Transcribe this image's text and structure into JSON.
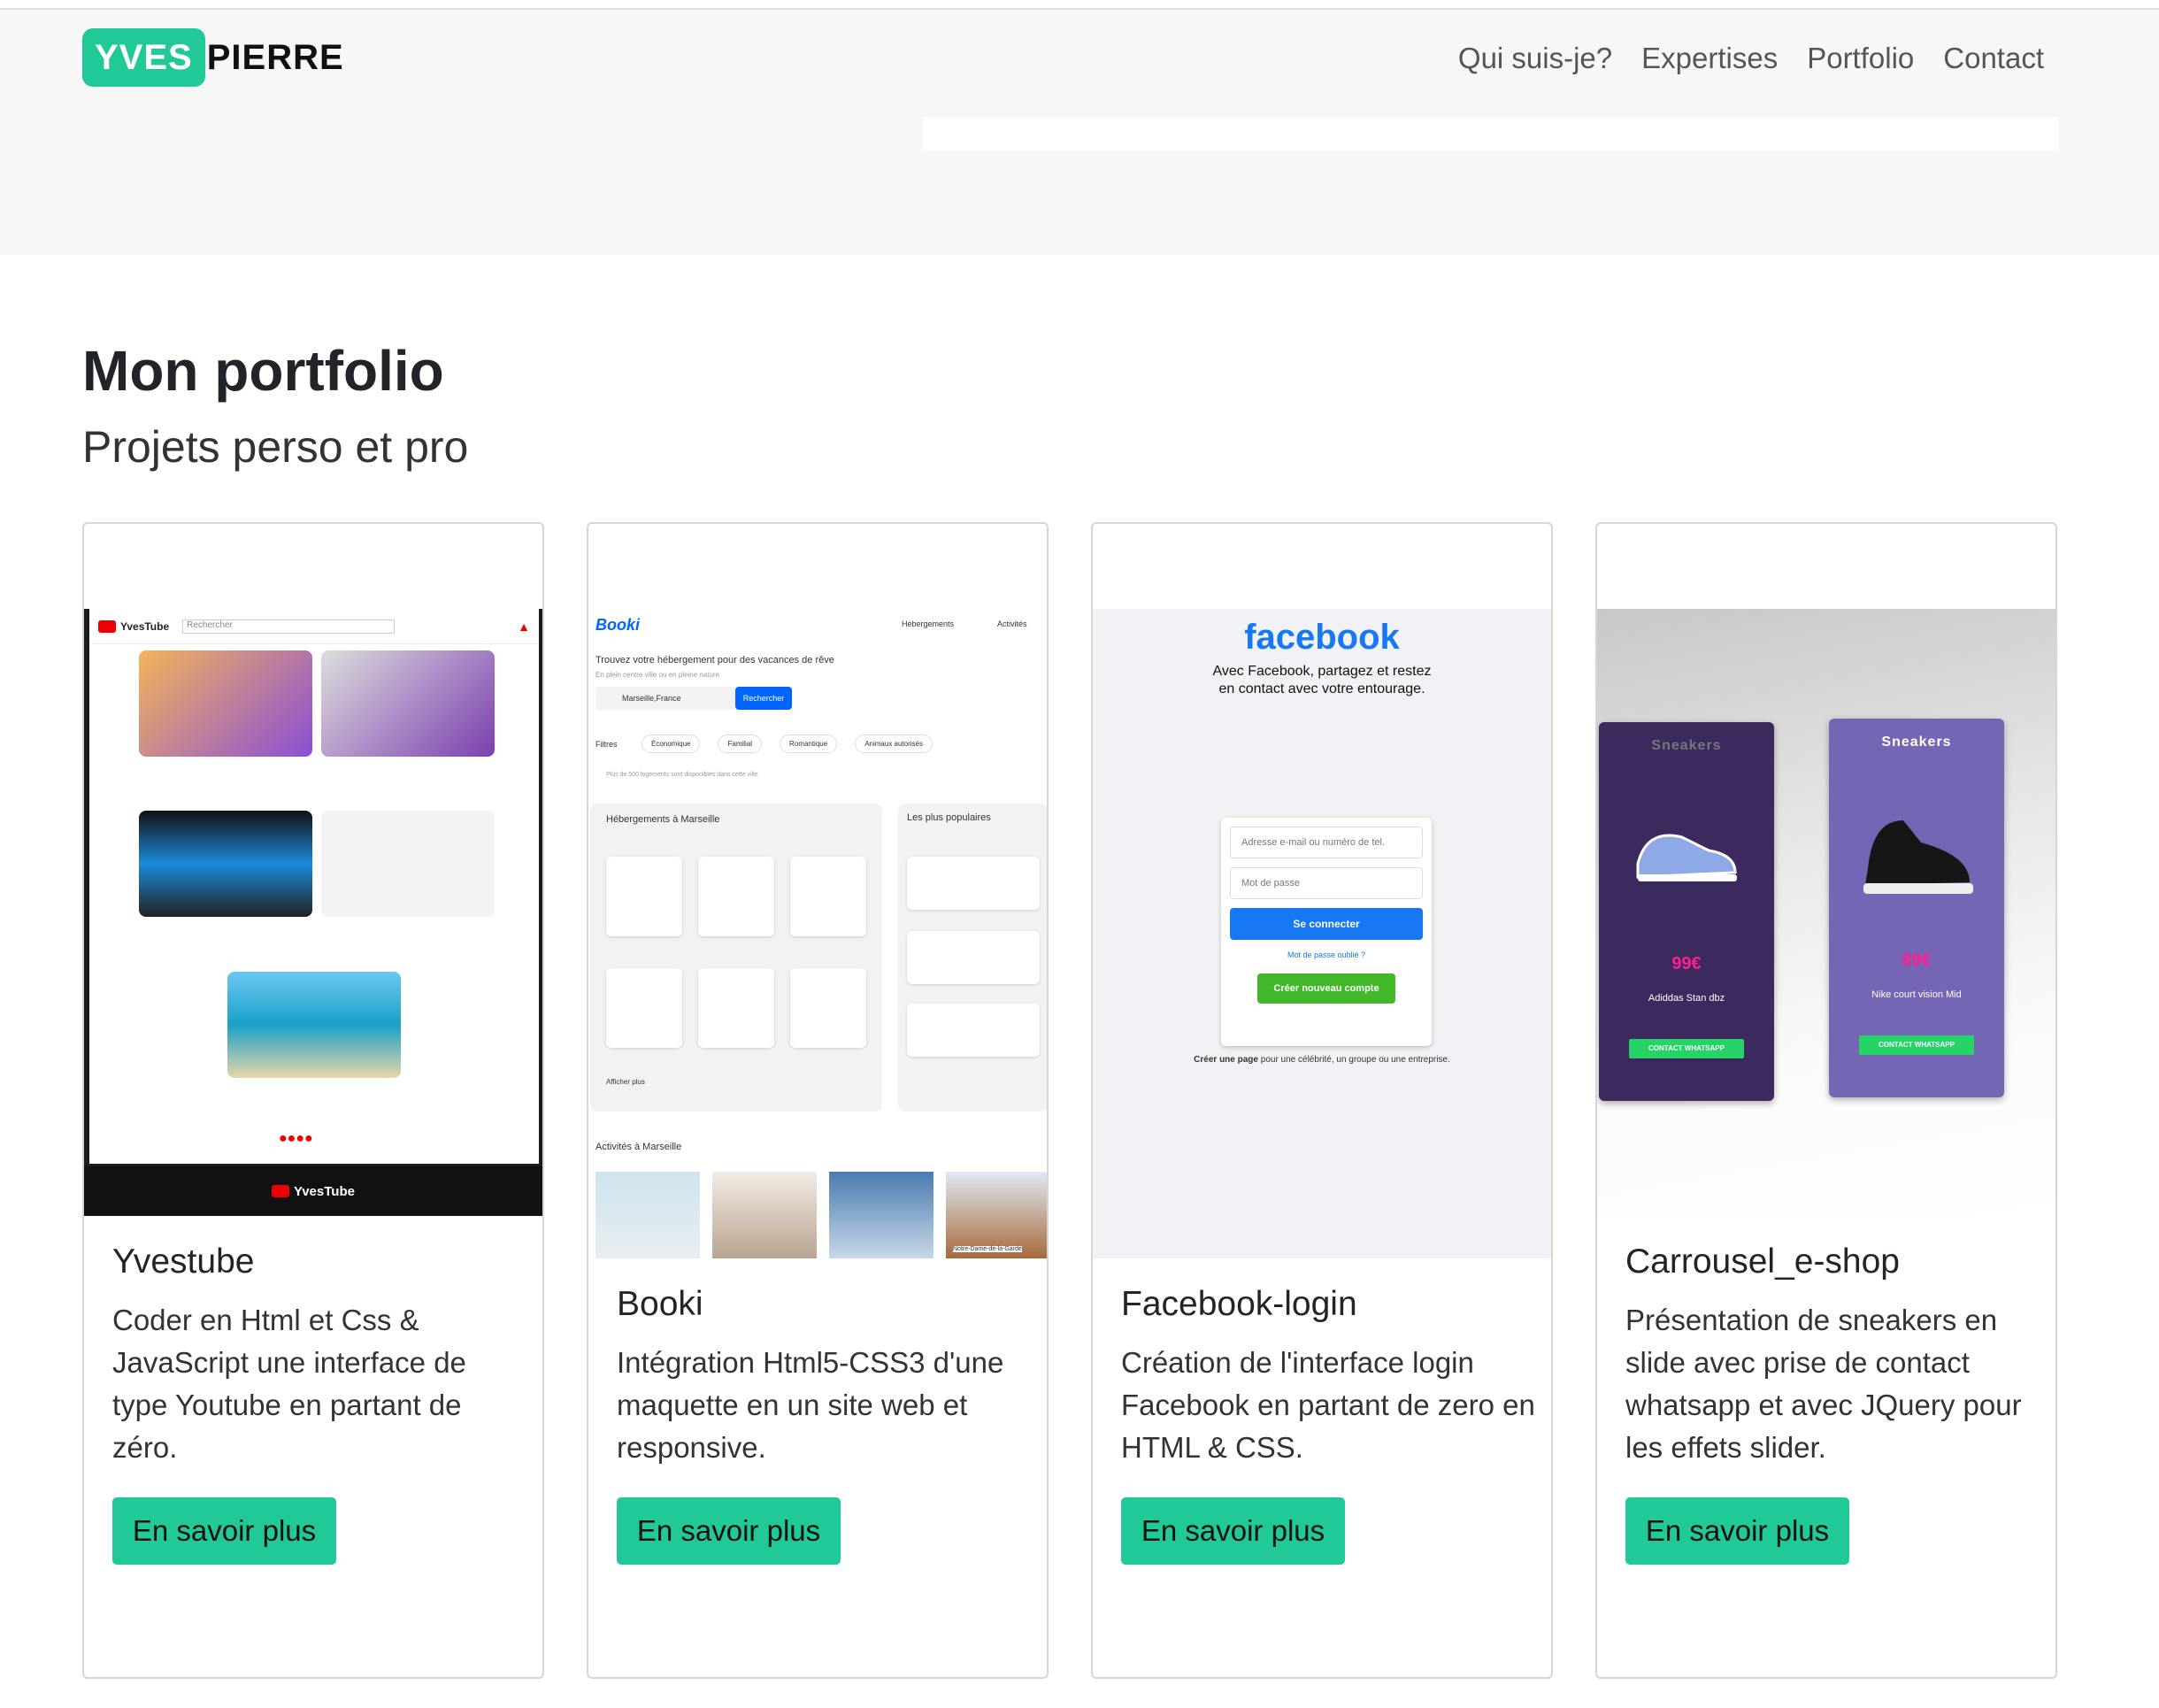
{
  "header": {
    "logo_first": "YVES",
    "logo_last": "PIERRE",
    "nav": [
      "Qui suis-je?",
      "Expertises",
      "Portfolio",
      "Contact"
    ]
  },
  "main": {
    "title": "Mon portfolio",
    "subtitle": "Projets perso et pro"
  },
  "cards": [
    {
      "title": "Yvestube",
      "text": "Coder en Html et Css & JavaScript une interface de type Youtube en partant de zéro.",
      "button": "En savoir plus",
      "thumb": {
        "brand": "YvesTube",
        "search": "Rechercher"
      }
    },
    {
      "title": "Booki",
      "text": "Intégration Html5-CSS3 d'une maquette en un site web et responsive.",
      "button": "En savoir plus",
      "thumb": {
        "brand": "Booki",
        "nav1": "Hébergements",
        "nav2": "Activités",
        "headline": "Trouvez votre hébergement pour des vacances de rêve",
        "sub": "En plein centre ville ou en pleine nature",
        "city": "Marseille,France",
        "search": "Rechercher",
        "filters_label": "Filtres",
        "filters": [
          "Économique",
          "Familial",
          "Romantique",
          "Animaux autorisés"
        ],
        "info": "Plus de 500 logements sont disponibles dans cette ville",
        "lodgings": "Hébergements à Marseille",
        "popular": "Les plus populaires",
        "more": "Afficher plus",
        "activities": "Activités à Marseille",
        "caption": "Notre-Dame-de-la-Garde"
      }
    },
    {
      "title": "Facebook-login",
      "text": "Création de l'interface login Facebook en partant de zero en HTML & CSS.",
      "button": "En savoir plus",
      "thumb": {
        "logo": "facebook",
        "tagline1": "Avec Facebook, partagez et restez",
        "tagline2": "en contact avec votre entourage.",
        "email": "Adresse e-mail ou numéro de tel.",
        "password": "Mot de passe",
        "login": "Se connecter",
        "forgot": "Mot de passe oublié ?",
        "create": "Créer nouveau compte",
        "page_bold": "Créer une page",
        "page_rest": "pour une célébrité, un groupe ou une entreprise."
      }
    },
    {
      "title": "Carrousel_e-shop",
      "text": "Présentation de sneakers en slide avec prise de contact whatsapp et avec JQuery pour les effets slider.",
      "button": "En savoir plus",
      "thumb": {
        "label": "Sneakers",
        "price1": "99€",
        "name1": "Adiddas Stan dbz",
        "price2": "89€",
        "name2": "Nike court vision Mid",
        "whatsapp": "CONTACT WHATSAPP"
      }
    }
  ],
  "colors": {
    "accent": "#20c997",
    "header_bg": "#f7f7f7"
  }
}
